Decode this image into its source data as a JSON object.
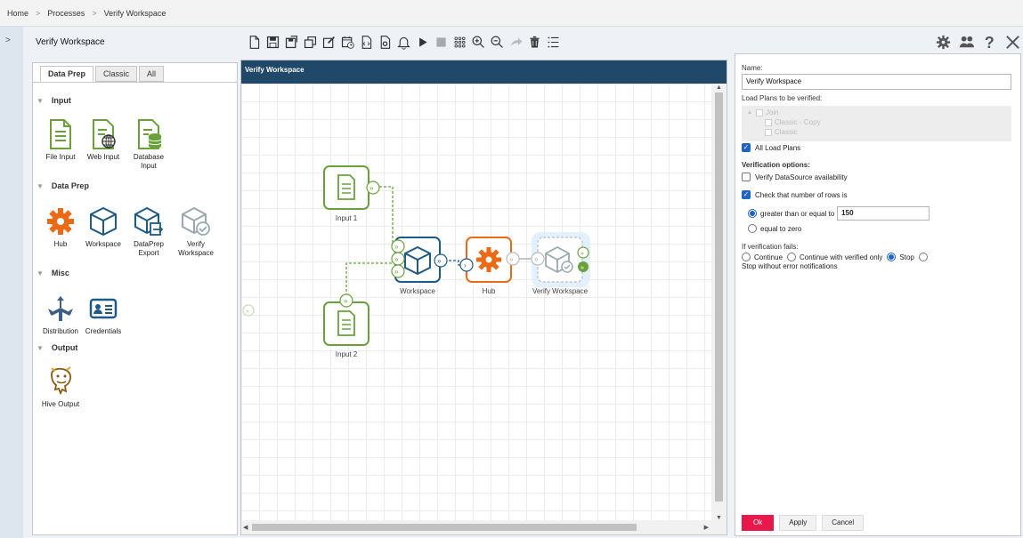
{
  "breadcrumb": {
    "home": "Home",
    "processes": "Processes",
    "current": "Verify Workspace",
    "separator": ">"
  },
  "header": {
    "title": "Verify Workspace"
  },
  "palette": {
    "tabs": [
      "Data Prep",
      "Classic",
      "All"
    ],
    "sections": {
      "input": "Input",
      "dataprep": "Data Prep",
      "misc": "Misc",
      "output": "Output"
    },
    "tools": {
      "file_input": "File Input",
      "web_input": "Web Input",
      "database_input": "Database Input",
      "hub": "Hub",
      "workspace": "Workspace",
      "dataprep_export": "DataPrep Export",
      "verify_workspace": "Verify Workspace",
      "distribution": "Distribution",
      "credentials": "Credentials",
      "hive_output": "Hive Output"
    }
  },
  "canvas": {
    "title": "Verify Workspace",
    "nodes": {
      "input1": "Input 1",
      "input2": "Input 2",
      "workspace": "Workspace",
      "hub": "Hub",
      "verify": "Verify Workspace"
    }
  },
  "properties": {
    "name_label": "Name:",
    "name_value": "Verify Workspace",
    "load_plans_label": "Load Plans to be verified:",
    "load_plans": {
      "group": "Join",
      "item1": "Classic - Copy",
      "item2": "Classic"
    },
    "all_load_plans": "All Load Plans",
    "verification_options_label": "Verification options:",
    "verify_datasource": "Verify DataSource availability",
    "check_rows": "Check that number of rows is",
    "greater_equal": "greater than or equal to",
    "rows_value": "150",
    "equal_zero": "equal to zero",
    "if_fails_label": "If verification fails:",
    "fail_options": {
      "continue": "Continue",
      "continue_verified": "Continue with verified only",
      "stop": "Stop",
      "stop_no_error": "Stop without error notifications"
    },
    "buttons": {
      "ok": "Ok",
      "apply": "Apply",
      "cancel": "Cancel"
    }
  },
  "colors": {
    "header_bar": "#1f4869",
    "accent": "#e8194a",
    "input_green": "#6aa23a",
    "hub_orange": "#ea6a16",
    "workspace_blue": "#1e5a86"
  }
}
